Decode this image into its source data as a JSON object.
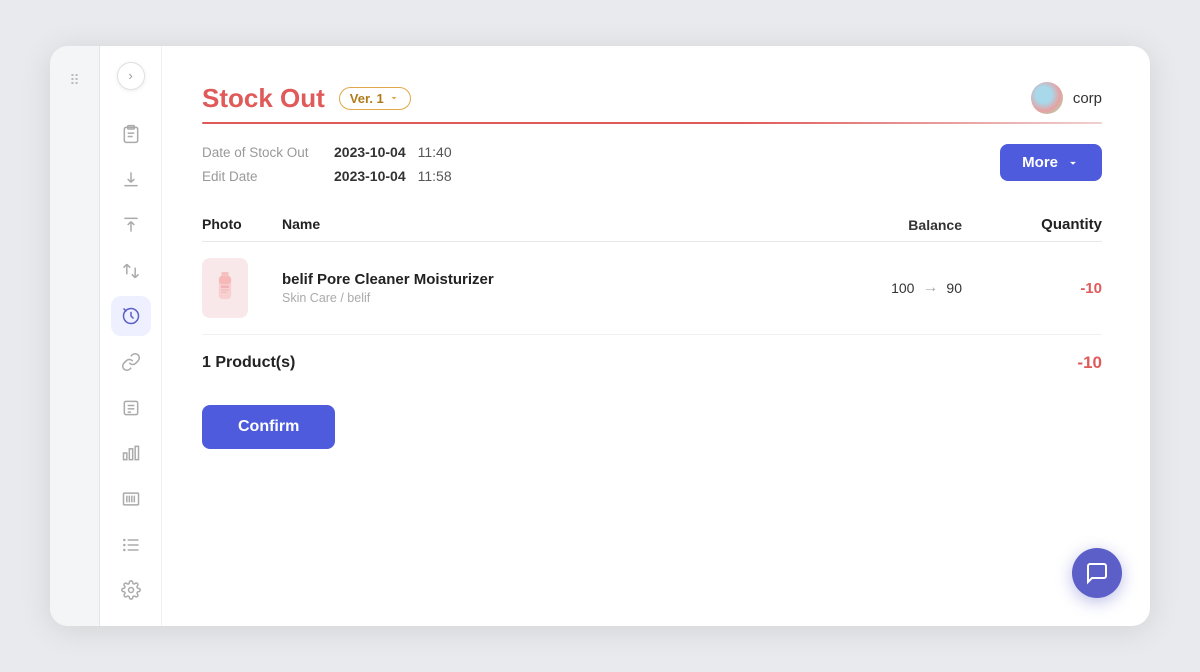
{
  "page": {
    "title": "Stock Out",
    "version": "Ver. 1",
    "corp": "corp"
  },
  "meta": {
    "date_label": "Date of Stock Out",
    "date_value": "2023-10-04",
    "date_time": "11:40",
    "edit_label": "Edit Date",
    "edit_date": "2023-10-04",
    "edit_time": "11:58"
  },
  "buttons": {
    "more": "More",
    "confirm": "Confirm"
  },
  "table": {
    "col_photo": "Photo",
    "col_name": "Name",
    "col_balance": "Balance",
    "col_quantity": "Quantity",
    "rows": [
      {
        "name": "belif Pore Cleaner Moisturizer",
        "category": "Skin Care / belif",
        "balance_from": "100",
        "balance_to": "90",
        "quantity": "-10"
      }
    ]
  },
  "summary": {
    "label": "1 Product(s)",
    "total": "-10"
  },
  "sidebar": {
    "icons": [
      "⬒",
      "⬇",
      "⬆",
      "⇅",
      "↩",
      "🔗",
      "≡",
      "▦",
      "☰",
      "⚙"
    ]
  },
  "colors": {
    "accent_red": "#e05a5a",
    "accent_blue": "#4f5bdd",
    "version_border": "#e0a84a",
    "version_text": "#b07c1a"
  }
}
